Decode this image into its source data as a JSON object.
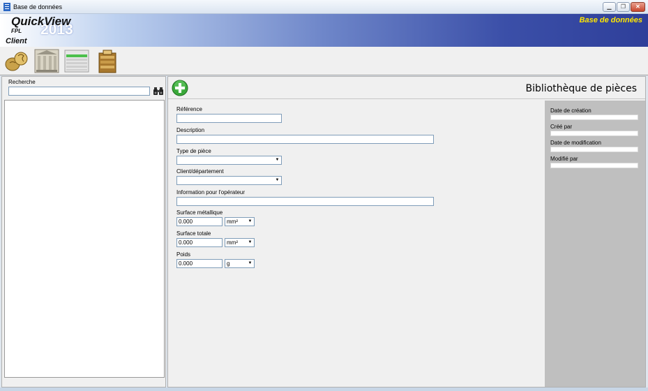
{
  "window": {
    "title": "Base de données",
    "controls": [
      "minimize-icon",
      "restore-icon",
      "close-icon"
    ]
  },
  "banner": {
    "logo_main": "QuickView",
    "logo_year": "2013",
    "logo_sub": "FPL",
    "module_label": "Client",
    "section_label": "Base de données",
    "section_label_color": "#ffe600"
  },
  "toolbar": {
    "tools": [
      "coins-icon",
      "building-icon",
      "list-document-icon",
      "gold-bars-icon"
    ]
  },
  "search": {
    "label": "Recherche",
    "value": "",
    "button_icon": "binoculars-icon"
  },
  "main": {
    "add_icon": "add-icon",
    "title": "Bibliothèque de pièces",
    "fields": {
      "reference": {
        "label": "Référence",
        "value": ""
      },
      "description": {
        "label": "Description",
        "value": ""
      },
      "type": {
        "label": "Type de pièce",
        "value": ""
      },
      "client": {
        "label": "Client/département",
        "value": ""
      },
      "operator_info": {
        "label": "Information pour l'opérateur",
        "value": ""
      },
      "metal_surface": {
        "label": "Surface métallique",
        "value": "0.000",
        "unit": "mm²"
      },
      "total_surface": {
        "label": "Surface totale",
        "value": "0.000",
        "unit": "mm²"
      },
      "weight": {
        "label": "Poids",
        "value": "0.000",
        "unit": "g"
      }
    }
  },
  "meta": {
    "created_date": {
      "label": "Date de création",
      "value": ""
    },
    "created_by": {
      "label": "Créé par",
      "value": ""
    },
    "modified_date": {
      "label": "Date de modification",
      "value": ""
    },
    "modified_by": {
      "label": "Modifié par",
      "value": ""
    }
  }
}
